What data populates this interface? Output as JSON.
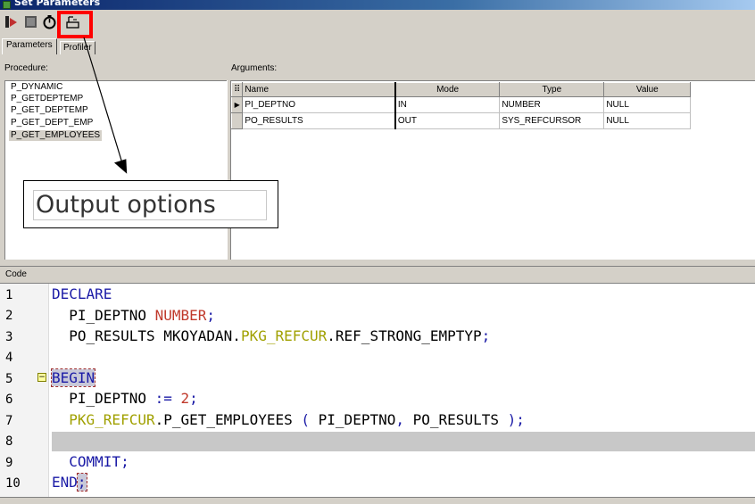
{
  "window": {
    "title": "Set Parameters"
  },
  "toolbar": {
    "buttons": [
      {
        "icon": "debug-icon",
        "label": ""
      },
      {
        "icon": "stop-icon",
        "label": ""
      },
      {
        "icon": "timer-icon",
        "label": ""
      },
      {
        "icon": "output-options-icon",
        "label": ""
      }
    ]
  },
  "tabs": {
    "parameters": "Parameters",
    "profiler": "Profiler"
  },
  "procedure": {
    "label": "Procedure:",
    "items": [
      "P_DYNAMIC",
      "P_GETDEPTEMP",
      "P_GET_DEPTEMP",
      "P_GET_DEPT_EMP",
      "P_GET_EMPLOYEES"
    ],
    "selected": "P_GET_EMPLOYEES"
  },
  "arguments": {
    "label": "Arguments:",
    "columns": [
      "Name",
      "Mode",
      "Type",
      "Value"
    ],
    "rows": [
      {
        "name": "PI_DEPTNO",
        "mode": "IN",
        "type": "NUMBER",
        "value": "NULL"
      },
      {
        "name": "PO_RESULTS",
        "mode": "OUT",
        "type": "SYS_REFCURSOR",
        "value": "NULL"
      }
    ]
  },
  "annotation": {
    "text": "Output options"
  },
  "code": {
    "label": "Code",
    "line_numbers": [
      "1",
      "2",
      "3",
      "4",
      "5",
      "6",
      "7",
      "8",
      "9",
      "10"
    ],
    "lines": {
      "l1": {
        "kw": "DECLARE"
      },
      "l2": {
        "name": "PI_DEPTNO",
        "type": "NUMBER",
        "end": ";"
      },
      "l3": {
        "name": "PO_RESULTS",
        "owner": "MKOYADAN",
        "dot1": ".",
        "pkg": "PKG_REFCUR",
        "dot2": ".",
        "type": "REF_STRONG_EMPTYP",
        "end": ";"
      },
      "l5": {
        "kw": "BEGIN"
      },
      "l6": {
        "name": "PI_DEPTNO",
        "op": ":=",
        "num": "2",
        "end": ";"
      },
      "l7": {
        "pkg": "PKG_REFCUR",
        "dot": ".",
        "proc": "P_GET_EMPLOYEES",
        "open": "(",
        "arg1": "PI_DEPTNO",
        "comma": ",",
        "arg2": "PO_RESULTS",
        "close": ")",
        "end": ";"
      },
      "l9": {
        "kw": "COMMIT",
        "end": ";"
      },
      "l10": {
        "kw": "END",
        "end": ";"
      }
    }
  },
  "colors": {
    "highlight": "#ff0000",
    "keyword": "#1a1aa6",
    "type": "#c0392b",
    "package": "#a0a000"
  }
}
